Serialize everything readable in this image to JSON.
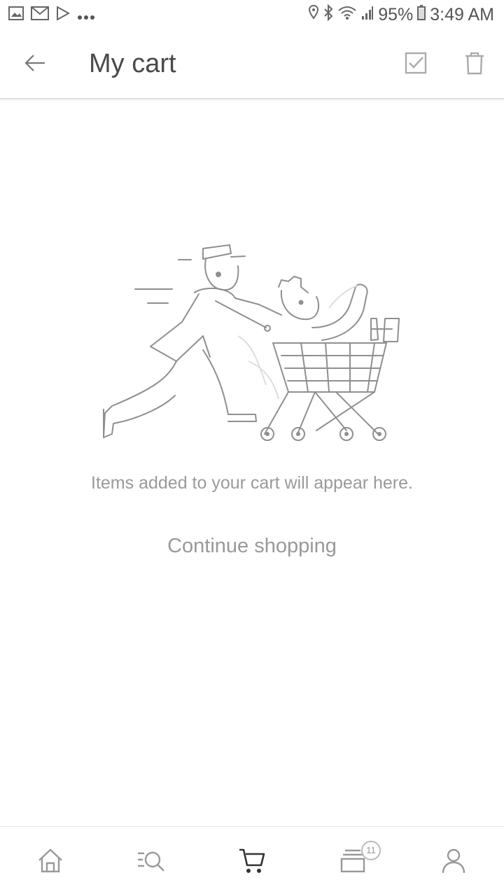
{
  "status_bar": {
    "battery": "95%",
    "time": "3:49 AM",
    "left_icons": [
      "gallery-icon",
      "email-icon",
      "play-store-icon",
      "more-dots-icon"
    ],
    "right_icons": [
      "location-icon",
      "bluetooth-icon",
      "wifi-icon",
      "signal-icon",
      "battery-icon"
    ]
  },
  "app_bar": {
    "title": "My cart",
    "back_icon": "arrow-left-icon",
    "select_icon": "checkbox-icon",
    "delete_icon": "trash-icon"
  },
  "empty_state": {
    "illustration": "person-pushing-shopping-cart-icon",
    "message": "Items added to your cart will appear here.",
    "continue_label": "Continue shopping"
  },
  "bottom_nav": {
    "items": [
      {
        "icon": "home-icon"
      },
      {
        "icon": "category-search-icon"
      },
      {
        "icon": "cart-icon",
        "active": true
      },
      {
        "icon": "orders-icon",
        "badge": "11"
      },
      {
        "icon": "account-icon"
      }
    ]
  },
  "colors": {
    "text_primary": "#4a4a4a",
    "text_muted": "#9a9a9a",
    "icon_gray": "#9e9e9e",
    "active_icon": "#333333"
  }
}
